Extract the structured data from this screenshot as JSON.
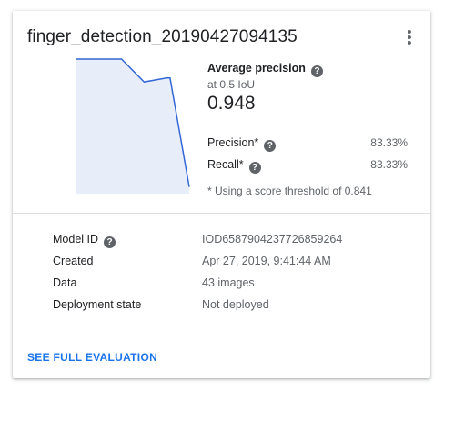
{
  "card": {
    "title": "finger_detection_20190427094135",
    "menu_icon": "more-vert-icon"
  },
  "metrics": {
    "average_precision_label": "Average precision",
    "average_precision_sub": "at 0.5 IoU",
    "average_precision_value": "0.948",
    "precision_label": "Precision*",
    "precision_value": "83.33%",
    "recall_label": "Recall*",
    "recall_value": "83.33%",
    "threshold_note": "* Using a score threshold of 0.841",
    "help_icon": "help-icon"
  },
  "chart_data": {
    "type": "area",
    "series": [
      {
        "x": [
          0.0,
          0.4,
          0.6,
          0.8,
          0.83,
          1.0
        ],
        "y": [
          1.0,
          1.0,
          0.83,
          0.86,
          0.86,
          0.05
        ]
      }
    ],
    "xlim": [
      0,
      1
    ],
    "ylim": [
      0,
      1
    ],
    "grid": false,
    "colors": {
      "line": "#3367d6",
      "fill": "#e8eef9"
    }
  },
  "details": {
    "rows": [
      {
        "label": "Model ID",
        "value": "IOD6587904237726859264",
        "has_help": true
      },
      {
        "label": "Created",
        "value": "Apr 27, 2019, 9:41:44 AM",
        "has_help": false
      },
      {
        "label": "Data",
        "value": "43 images",
        "has_help": false
      },
      {
        "label": "Deployment state",
        "value": "Not deployed",
        "has_help": false
      }
    ]
  },
  "footer": {
    "link_label": "SEE FULL EVALUATION",
    "link_color": "#1a73e8"
  }
}
